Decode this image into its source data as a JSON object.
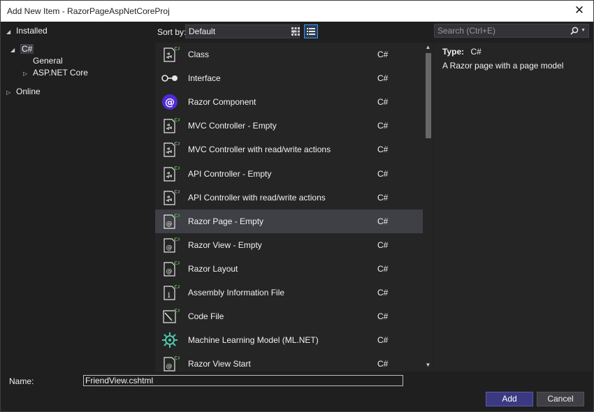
{
  "window": {
    "title": "Add New Item - RazorPageAspNetCoreProj",
    "close_glyph": "✕"
  },
  "tree": {
    "installed": "Installed",
    "csharp": "C#",
    "general": "General",
    "aspnet_core": "ASP.NET Core",
    "online": "Online"
  },
  "toolbar": {
    "sort_label": "Sort by:",
    "sort_value": "Default"
  },
  "search": {
    "placeholder": "Search (Ctrl+E)"
  },
  "items": [
    {
      "name": "Class",
      "lang": "C#",
      "icon": "class-icon"
    },
    {
      "name": "Interface",
      "lang": "C#",
      "icon": "interface-icon"
    },
    {
      "name": "Razor Component",
      "lang": "C#",
      "icon": "razor-component-icon"
    },
    {
      "name": "MVC Controller - Empty",
      "lang": "C#",
      "icon": "controller-icon"
    },
    {
      "name": "MVC Controller with read/write actions",
      "lang": "C#",
      "icon": "controller-icon"
    },
    {
      "name": "API Controller - Empty",
      "lang": "C#",
      "icon": "controller-icon"
    },
    {
      "name": "API Controller with read/write actions",
      "lang": "C#",
      "icon": "controller-icon"
    },
    {
      "name": "Razor Page - Empty",
      "lang": "C#",
      "icon": "razor-page-icon",
      "selected": true
    },
    {
      "name": "Razor View - Empty",
      "lang": "C#",
      "icon": "razor-view-icon"
    },
    {
      "name": "Razor Layout",
      "lang": "C#",
      "icon": "razor-layout-icon"
    },
    {
      "name": "Assembly Information File",
      "lang": "C#",
      "icon": "assembly-info-icon"
    },
    {
      "name": "Code File",
      "lang": "C#",
      "icon": "code-file-icon"
    },
    {
      "name": "Machine Learning Model (ML.NET)",
      "lang": "C#",
      "icon": "ml-model-icon"
    },
    {
      "name": "Razor View Start",
      "lang": "C#",
      "icon": "razor-view-start-icon"
    }
  ],
  "details": {
    "type_label": "Type:",
    "type_value": "C#",
    "description": "A Razor page with a page model"
  },
  "bottom": {
    "name_label": "Name:",
    "name_value": "FriendView.cshtml",
    "add_label": "Add",
    "cancel_label": "Cancel"
  },
  "colors": {
    "accent": "#3b3a80",
    "selection": "#3f3f46",
    "csharp_badge": "#57a64a"
  }
}
